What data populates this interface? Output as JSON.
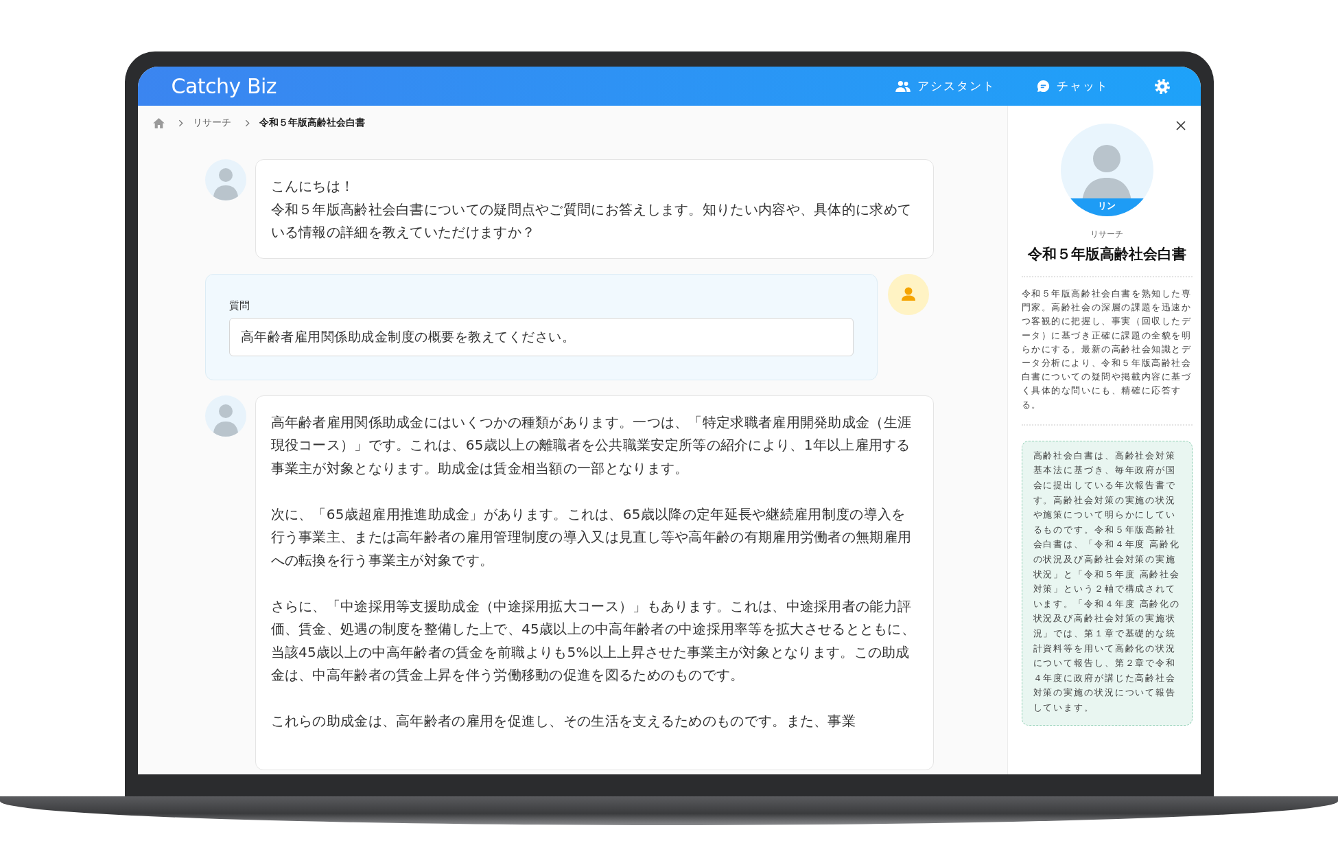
{
  "header": {
    "logo": "Catchy Biz",
    "nav": [
      {
        "kind": "people",
        "label": "アシスタント"
      },
      {
        "kind": "chat",
        "label": "チャット"
      }
    ]
  },
  "breadcrumb": [
    "リサーチ",
    "令和５年版高齢社会白書"
  ],
  "messages": [
    {
      "kind": "assistant",
      "paragraphs": [
        "こんにちは！",
        "令和５年版高齢社会白書についての疑問点やご質問にお答えします。知りたい内容や、具体的に求めている情報の詳細を教えていただけますか？"
      ]
    },
    {
      "kind": "question",
      "label": "質問",
      "value": "高年齢者雇用関係助成金制度の概要を教えてください。"
    },
    {
      "kind": "assistant",
      "paragraphs": [
        "高年齢者雇用関係助成金にはいくつかの種類があります。一つは、「特定求職者雇用開発助成金（生涯現役コース）」です。これは、65歳以上の離職者を公共職業安定所等の紹介により、1年以上雇用する事業主が対象となります。助成金は賃金相当額の一部となります。",
        "次に、「65歳超雇用推進助成金」があります。これは、65歳以降の定年延長や継続雇用制度の導入を行う事業主、または高年齢者の雇用管理制度の導入又は見直し等や高年齢の有期雇用労働者の無期雇用への転換を行う事業主が対象です。",
        "さらに、「中途採用等支援助成金（中途採用拡大コース）」もあります。これは、中途採用者の能力評価、賃金、処遇の制度を整備した上で、45歳以上の中高年齢者の中途採用率等を拡大させるとともに、当該45歳以上の中高年齢者の賃金を前職よりも5%以上上昇させた事業主が対象となります。この助成金は、中高年齢者の賃金上昇を伴う労働移動の促進を図るためのものです。",
        "これらの助成金は、高年齢者の雇用を促進し、その生活を支えるためのものです。また、事業"
      ]
    }
  ],
  "panel": {
    "avatar_name": "リン",
    "category": "リサーチ",
    "title": "令和５年版高齢社会白書",
    "description": "令和５年版高齢社会白書を熟知した専門家。高齢社会の深層の課題を迅速かつ客観的に把握し、事実（回収したデータ）に基づき正確に課題の全貌を明らかにする。最新の高齢社会知識とデータ分析により、令和５年版高齢社会白書についての疑問や掲載内容に基づく具体的な問いにも、精確に応答する。",
    "note": "高齢社会白書は、高齢社会対策基本法に基づき、毎年政府が国会に提出している年次報告書です。高齢社会対策の実施の状況や施策について明らかにしているものです。令和５年版高齢社会白書は、「令和４年度 高齢化の状況及び高齢社会対策の実施状況」と「令和５年度 高齢社会対策」という２軸で構成されています。「令和４年度 高齢化の状況及び高齢社会対策の実施状況」では、第１章で基礎的な統計資料等を用いて高齢化の状況について報告し、第２章で令和４年度に政府が講じた高齢社会対策の実施の状況について報告しています。"
  }
}
